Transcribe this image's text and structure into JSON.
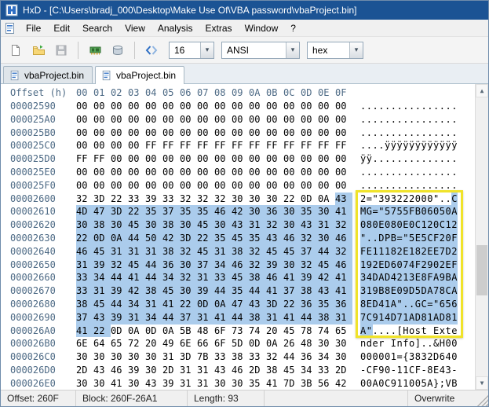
{
  "colors": {
    "titlebar": "#1b5394",
    "selection": "#abccec",
    "yellow": "#f0e32a",
    "offsetcol": "#4d6a85"
  },
  "window": {
    "title": "HxD - [C:\\Users\\bradj_000\\Desktop\\Make Use Of\\VBA password\\vbaProject.bin]"
  },
  "menu": [
    "File",
    "Edit",
    "Search",
    "View",
    "Analysis",
    "Extras",
    "Window",
    "?"
  ],
  "toolbar": {
    "icon_names": [
      "new-file-icon",
      "open-folder-icon",
      "save-icon",
      "open-ram-icon",
      "open-disk-icon",
      "navigate-arrows-icon",
      "chevron-down-icon"
    ],
    "bytes_per_row": "16",
    "encoding": "ANSI",
    "offset_base": "hex"
  },
  "tabs": [
    {
      "label": "vbaProject.bin",
      "active": false
    },
    {
      "label": "vbaProject.bin",
      "active": true
    }
  ],
  "editor": {
    "offset_header": "Offset (h)",
    "byte_headers": [
      "00",
      "01",
      "02",
      "03",
      "04",
      "05",
      "06",
      "07",
      "08",
      "09",
      "0A",
      "0B",
      "0C",
      "0D",
      "0E",
      "0F"
    ],
    "rows": [
      {
        "offset": "00002590",
        "bytes": [
          "00",
          "00",
          "00",
          "00",
          "00",
          "00",
          "00",
          "00",
          "00",
          "00",
          "00",
          "00",
          "00",
          "00",
          "00",
          "00"
        ],
        "text": "................",
        "sel": null
      },
      {
        "offset": "000025A0",
        "bytes": [
          "00",
          "00",
          "00",
          "00",
          "00",
          "00",
          "00",
          "00",
          "00",
          "00",
          "00",
          "00",
          "00",
          "00",
          "00",
          "00"
        ],
        "text": "................",
        "sel": null
      },
      {
        "offset": "000025B0",
        "bytes": [
          "00",
          "00",
          "00",
          "00",
          "00",
          "00",
          "00",
          "00",
          "00",
          "00",
          "00",
          "00",
          "00",
          "00",
          "00",
          "00"
        ],
        "text": "................",
        "sel": null
      },
      {
        "offset": "000025C0",
        "bytes": [
          "00",
          "00",
          "00",
          "00",
          "FF",
          "FF",
          "FF",
          "FF",
          "FF",
          "FF",
          "FF",
          "FF",
          "FF",
          "FF",
          "FF",
          "FF"
        ],
        "text": "....ÿÿÿÿÿÿÿÿÿÿÿÿ",
        "sel": null
      },
      {
        "offset": "000025D0",
        "bytes": [
          "FF",
          "FF",
          "00",
          "00",
          "00",
          "00",
          "00",
          "00",
          "00",
          "00",
          "00",
          "00",
          "00",
          "00",
          "00",
          "00"
        ],
        "text": "ÿÿ..............",
        "sel": null
      },
      {
        "offset": "000025E0",
        "bytes": [
          "00",
          "00",
          "00",
          "00",
          "00",
          "00",
          "00",
          "00",
          "00",
          "00",
          "00",
          "00",
          "00",
          "00",
          "00",
          "00"
        ],
        "text": "................",
        "sel": null
      },
      {
        "offset": "000025F0",
        "bytes": [
          "00",
          "00",
          "00",
          "00",
          "00",
          "00",
          "00",
          "00",
          "00",
          "00",
          "00",
          "00",
          "00",
          "00",
          "00",
          "00"
        ],
        "text": "................",
        "sel": null
      },
      {
        "offset": "00002600",
        "bytes": [
          "32",
          "3D",
          "22",
          "33",
          "39",
          "33",
          "32",
          "32",
          "32",
          "30",
          "30",
          "30",
          "22",
          "0D",
          "0A",
          "43"
        ],
        "text": "2=\"393222000\"..C",
        "sel": [
          15,
          15
        ]
      },
      {
        "offset": "00002610",
        "bytes": [
          "4D",
          "47",
          "3D",
          "22",
          "35",
          "37",
          "35",
          "35",
          "46",
          "42",
          "30",
          "36",
          "30",
          "35",
          "30",
          "41"
        ],
        "text": "MG=\"5755FB06050A",
        "sel": [
          0,
          15
        ]
      },
      {
        "offset": "00002620",
        "bytes": [
          "30",
          "38",
          "30",
          "45",
          "30",
          "38",
          "30",
          "45",
          "30",
          "43",
          "31",
          "32",
          "30",
          "43",
          "31",
          "32"
        ],
        "text": "080E080E0C120C12",
        "sel": [
          0,
          15
        ]
      },
      {
        "offset": "00002630",
        "bytes": [
          "22",
          "0D",
          "0A",
          "44",
          "50",
          "42",
          "3D",
          "22",
          "35",
          "45",
          "35",
          "43",
          "46",
          "32",
          "30",
          "46"
        ],
        "text": "\"..DPB=\"5E5CF20F",
        "sel": [
          0,
          15
        ]
      },
      {
        "offset": "00002640",
        "bytes": [
          "46",
          "45",
          "31",
          "31",
          "31",
          "38",
          "32",
          "45",
          "31",
          "38",
          "32",
          "45",
          "45",
          "37",
          "44",
          "32"
        ],
        "text": "FE11182E182EE7D2",
        "sel": [
          0,
          15
        ]
      },
      {
        "offset": "00002650",
        "bytes": [
          "31",
          "39",
          "32",
          "45",
          "44",
          "36",
          "30",
          "37",
          "34",
          "46",
          "32",
          "39",
          "30",
          "32",
          "45",
          "46"
        ],
        "text": "192ED6074F2902EF",
        "sel": [
          0,
          15
        ]
      },
      {
        "offset": "00002660",
        "bytes": [
          "33",
          "34",
          "44",
          "41",
          "44",
          "34",
          "32",
          "31",
          "33",
          "45",
          "38",
          "46",
          "41",
          "39",
          "42",
          "41"
        ],
        "text": "34DAD4213E8FA9BA",
        "sel": [
          0,
          15
        ]
      },
      {
        "offset": "00002670",
        "bytes": [
          "33",
          "31",
          "39",
          "42",
          "38",
          "45",
          "30",
          "39",
          "44",
          "35",
          "44",
          "41",
          "37",
          "38",
          "43",
          "41"
        ],
        "text": "319B8E09D5DA78CA",
        "sel": [
          0,
          15
        ]
      },
      {
        "offset": "00002680",
        "bytes": [
          "38",
          "45",
          "44",
          "34",
          "31",
          "41",
          "22",
          "0D",
          "0A",
          "47",
          "43",
          "3D",
          "22",
          "36",
          "35",
          "36"
        ],
        "text": "8ED41A\"..GC=\"656",
        "sel": [
          0,
          15
        ]
      },
      {
        "offset": "00002690",
        "bytes": [
          "37",
          "43",
          "39",
          "31",
          "34",
          "44",
          "37",
          "31",
          "41",
          "44",
          "38",
          "31",
          "41",
          "44",
          "38",
          "31"
        ],
        "text": "7C914D71AD81AD81",
        "sel": [
          0,
          15
        ]
      },
      {
        "offset": "000026A0",
        "bytes": [
          "41",
          "22",
          "0D",
          "0A",
          "0D",
          "0A",
          "5B",
          "48",
          "6F",
          "73",
          "74",
          "20",
          "45",
          "78",
          "74",
          "65"
        ],
        "text": "A\"....[Host Exte",
        "sel": [
          0,
          1
        ]
      },
      {
        "offset": "000026B0",
        "bytes": [
          "6E",
          "64",
          "65",
          "72",
          "20",
          "49",
          "6E",
          "66",
          "6F",
          "5D",
          "0D",
          "0A",
          "26",
          "48",
          "30",
          "30"
        ],
        "text": "nder Info]..&H00",
        "sel": null
      },
      {
        "offset": "000026C0",
        "bytes": [
          "30",
          "30",
          "30",
          "30",
          "30",
          "31",
          "3D",
          "7B",
          "33",
          "38",
          "33",
          "32",
          "44",
          "36",
          "34",
          "30"
        ],
        "text": "000001={3832D640",
        "sel": null
      },
      {
        "offset": "000026D0",
        "bytes": [
          "2D",
          "43",
          "46",
          "39",
          "30",
          "2D",
          "31",
          "31",
          "43",
          "46",
          "2D",
          "38",
          "45",
          "34",
          "33",
          "2D"
        ],
        "text": "-CF90-11CF-8E43-",
        "sel": null
      },
      {
        "offset": "000026E0",
        "bytes": [
          "30",
          "30",
          "41",
          "30",
          "43",
          "39",
          "31",
          "31",
          "30",
          "30",
          "35",
          "41",
          "7D",
          "3B",
          "56",
          "42"
        ],
        "text": "00A0C911005A};VB",
        "sel": null
      }
    ]
  },
  "status": {
    "offset": "Offset: 260F",
    "block": "Block: 260F-26A1",
    "length": "Length: 93",
    "mode": "Overwrite"
  }
}
